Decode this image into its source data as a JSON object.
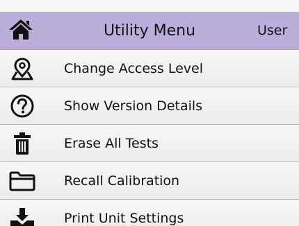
{
  "header": {
    "home_icon": "home-icon",
    "title": "Utility Menu",
    "user_label": "User",
    "color": "#bcaedb"
  },
  "menu": {
    "items": [
      {
        "label": "Change Access Level",
        "icon": "map-pin-icon"
      },
      {
        "label": "Show Version Details",
        "icon": "question-circle-icon"
      },
      {
        "label": "Erase All Tests",
        "icon": "trash-icon"
      },
      {
        "label": "Recall Calibration",
        "icon": "folder-icon"
      },
      {
        "label": "Print Unit Settings",
        "icon": "download-tray-icon"
      }
    ]
  }
}
